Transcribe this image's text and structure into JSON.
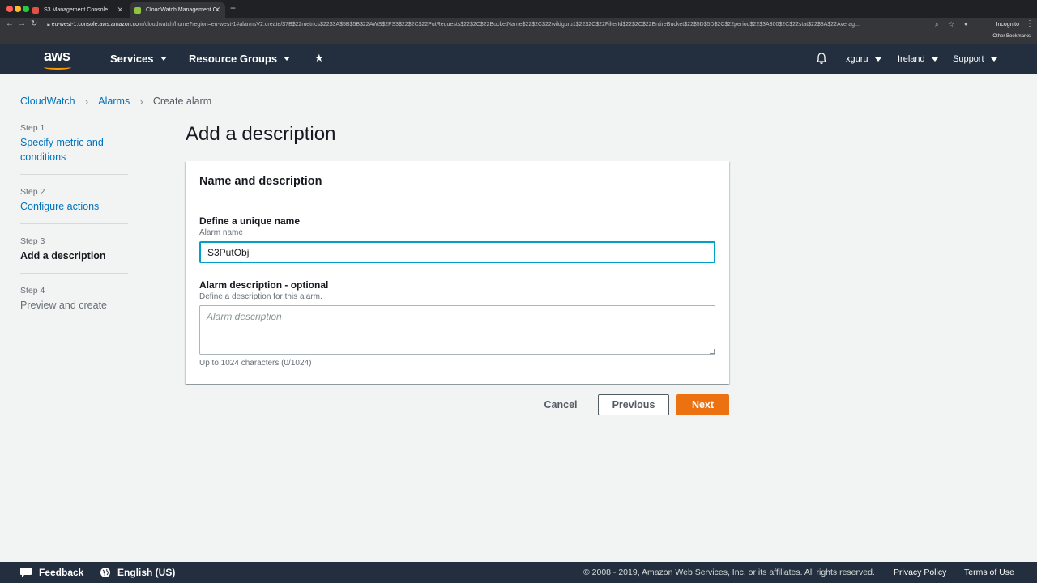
{
  "browser": {
    "tabs": [
      {
        "label": "S3 Management Console",
        "active": false
      },
      {
        "label": "CloudWatch Management Con",
        "active": true
      }
    ],
    "url_host": "eu-west-1.console.aws.amazon.com",
    "url_path": "/cloudwatch/home?region=eu-west-1#alarmsV2:create/$7B$22metrics$22$3A$5B$5B$22AWS$2FS3$22$2C$22PutRequests$22$2C$22BucketName$22$2C$22wildguru1$22$2C$22FilterId$22$2C$22EntireBucket$22$5D$5D$2C$22period$22$3A300$2C$22stat$22$3A$22Averag...",
    "incognito_label": "Incognito",
    "bookmarks_label": "Other Bookmarks"
  },
  "header": {
    "logo_text": "aws",
    "services_label": "Services",
    "resource_groups_label": "Resource Groups",
    "user_label": "xguru",
    "region_label": "Ireland",
    "support_label": "Support"
  },
  "breadcrumb": {
    "items": [
      "CloudWatch",
      "Alarms",
      "Create alarm"
    ]
  },
  "steps": [
    {
      "num": "Step 1",
      "label": "Specify metric and conditions",
      "state": "link"
    },
    {
      "num": "Step 2",
      "label": "Configure actions",
      "state": "link"
    },
    {
      "num": "Step 3",
      "label": "Add a description",
      "state": "current"
    },
    {
      "num": "Step 4",
      "label": "Preview and create",
      "state": "disabled"
    }
  ],
  "page_title": "Add a description",
  "card": {
    "title": "Name and description",
    "name_label": "Define a unique name",
    "name_sublabel": "Alarm name",
    "name_value": "S3PutObj",
    "desc_label": "Alarm description - optional",
    "desc_sublabel": "Define a description for this alarm.",
    "desc_placeholder": "Alarm description",
    "char_count": "Up to 1024 characters (0/1024)"
  },
  "buttons": {
    "cancel": "Cancel",
    "previous": "Previous",
    "next": "Next"
  },
  "footer": {
    "feedback": "Feedback",
    "language": "English (US)",
    "copyright": "© 2008 - 2019, Amazon Web Services, Inc. or its affiliates. All rights reserved.",
    "privacy": "Privacy Policy",
    "terms": "Terms of Use"
  },
  "colors": {
    "nav_bg": "#232f3e",
    "link": "#0073bb",
    "primary_button": "#ec7211",
    "focus": "#00a1c9"
  }
}
